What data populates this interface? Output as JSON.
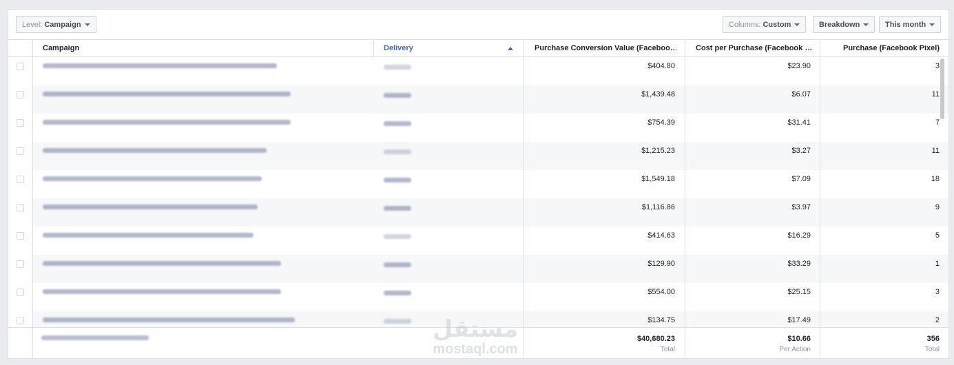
{
  "toolbar": {
    "level_prefix": "Level:",
    "level_value": "Campaign",
    "columns_prefix": "Columns:",
    "columns_value": "Custom",
    "breakdown": "Breakdown",
    "date_range": "This month"
  },
  "columns": {
    "campaign": "Campaign",
    "delivery": "Delivery",
    "purchase_value": "Purchase Conversion Value (Faceboo…",
    "cost_per_purchase": "Cost per Purchase (Facebook …",
    "purchases": "Purchase (Facebook Pixel)"
  },
  "rows": [
    {
      "value": "$404.80",
      "cost": "$23.90",
      "purchases": "3"
    },
    {
      "value": "$1,439.48",
      "cost": "$6.07",
      "purchases": "11"
    },
    {
      "value": "$754.39",
      "cost": "$31.41",
      "purchases": "7"
    },
    {
      "value": "$1,215.23",
      "cost": "$3.27",
      "purchases": "11"
    },
    {
      "value": "$1,549.18",
      "cost": "$7.09",
      "purchases": "18"
    },
    {
      "value": "$1,116.86",
      "cost": "$3.97",
      "purchases": "9"
    },
    {
      "value": "$414.63",
      "cost": "$16.29",
      "purchases": "5"
    },
    {
      "value": "$129.90",
      "cost": "$33.29",
      "purchases": "1"
    },
    {
      "value": "$554.00",
      "cost": "$25.15",
      "purchases": "3"
    },
    {
      "value": "$134.75",
      "cost": "$17.49",
      "purchases": "2"
    }
  ],
  "totals": {
    "value": "$40,680.23",
    "value_label": "Total",
    "cost": "$10.66",
    "cost_label": "Per Action",
    "purchases": "356",
    "purchases_label": "Total"
  },
  "watermark": {
    "text": "mostaql.com",
    "arabic": "مستقل"
  },
  "colors": {
    "link_blue": "#4267b2",
    "border": "#dddfe2",
    "alt_row": "#f6f7f9"
  }
}
